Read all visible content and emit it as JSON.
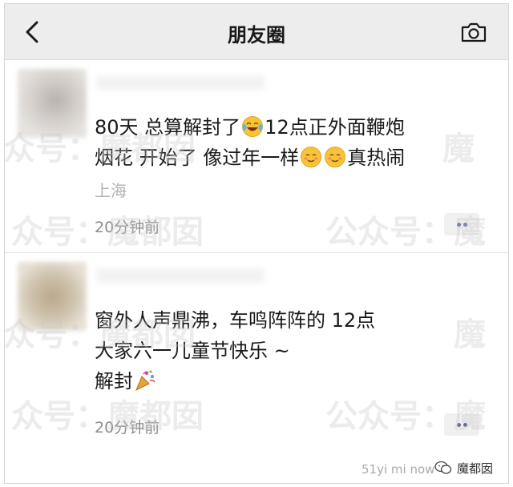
{
  "header": {
    "title": "朋友圈"
  },
  "posts": [
    {
      "text_line1_a": "80天  总算解封了",
      "text_line1_b": "12点正外面鞭炮",
      "text_line2_a": "烟花   开始了  像过年一样",
      "text_line2_b": "真热闹",
      "location": "上海",
      "time": "20分钟前"
    },
    {
      "text_line1": "窗外人声鼎沸，车鸣阵阵的 12点",
      "text_line2": "大家六一儿童节快乐 ~",
      "text_line3": "解封",
      "time": "20分钟前"
    }
  ],
  "watermarks": {
    "row_text_a": "众号：魔都囡",
    "row_text_b": "公众号：魔",
    "right_text": "魔",
    "footer_url": "51yi mi now",
    "badge_label": "魔都囡"
  },
  "colors": {
    "navbar_bg": "#ededed",
    "text_primary": "#191919",
    "text_secondary": "#8c8c8c",
    "link_blue": "#576b95"
  }
}
